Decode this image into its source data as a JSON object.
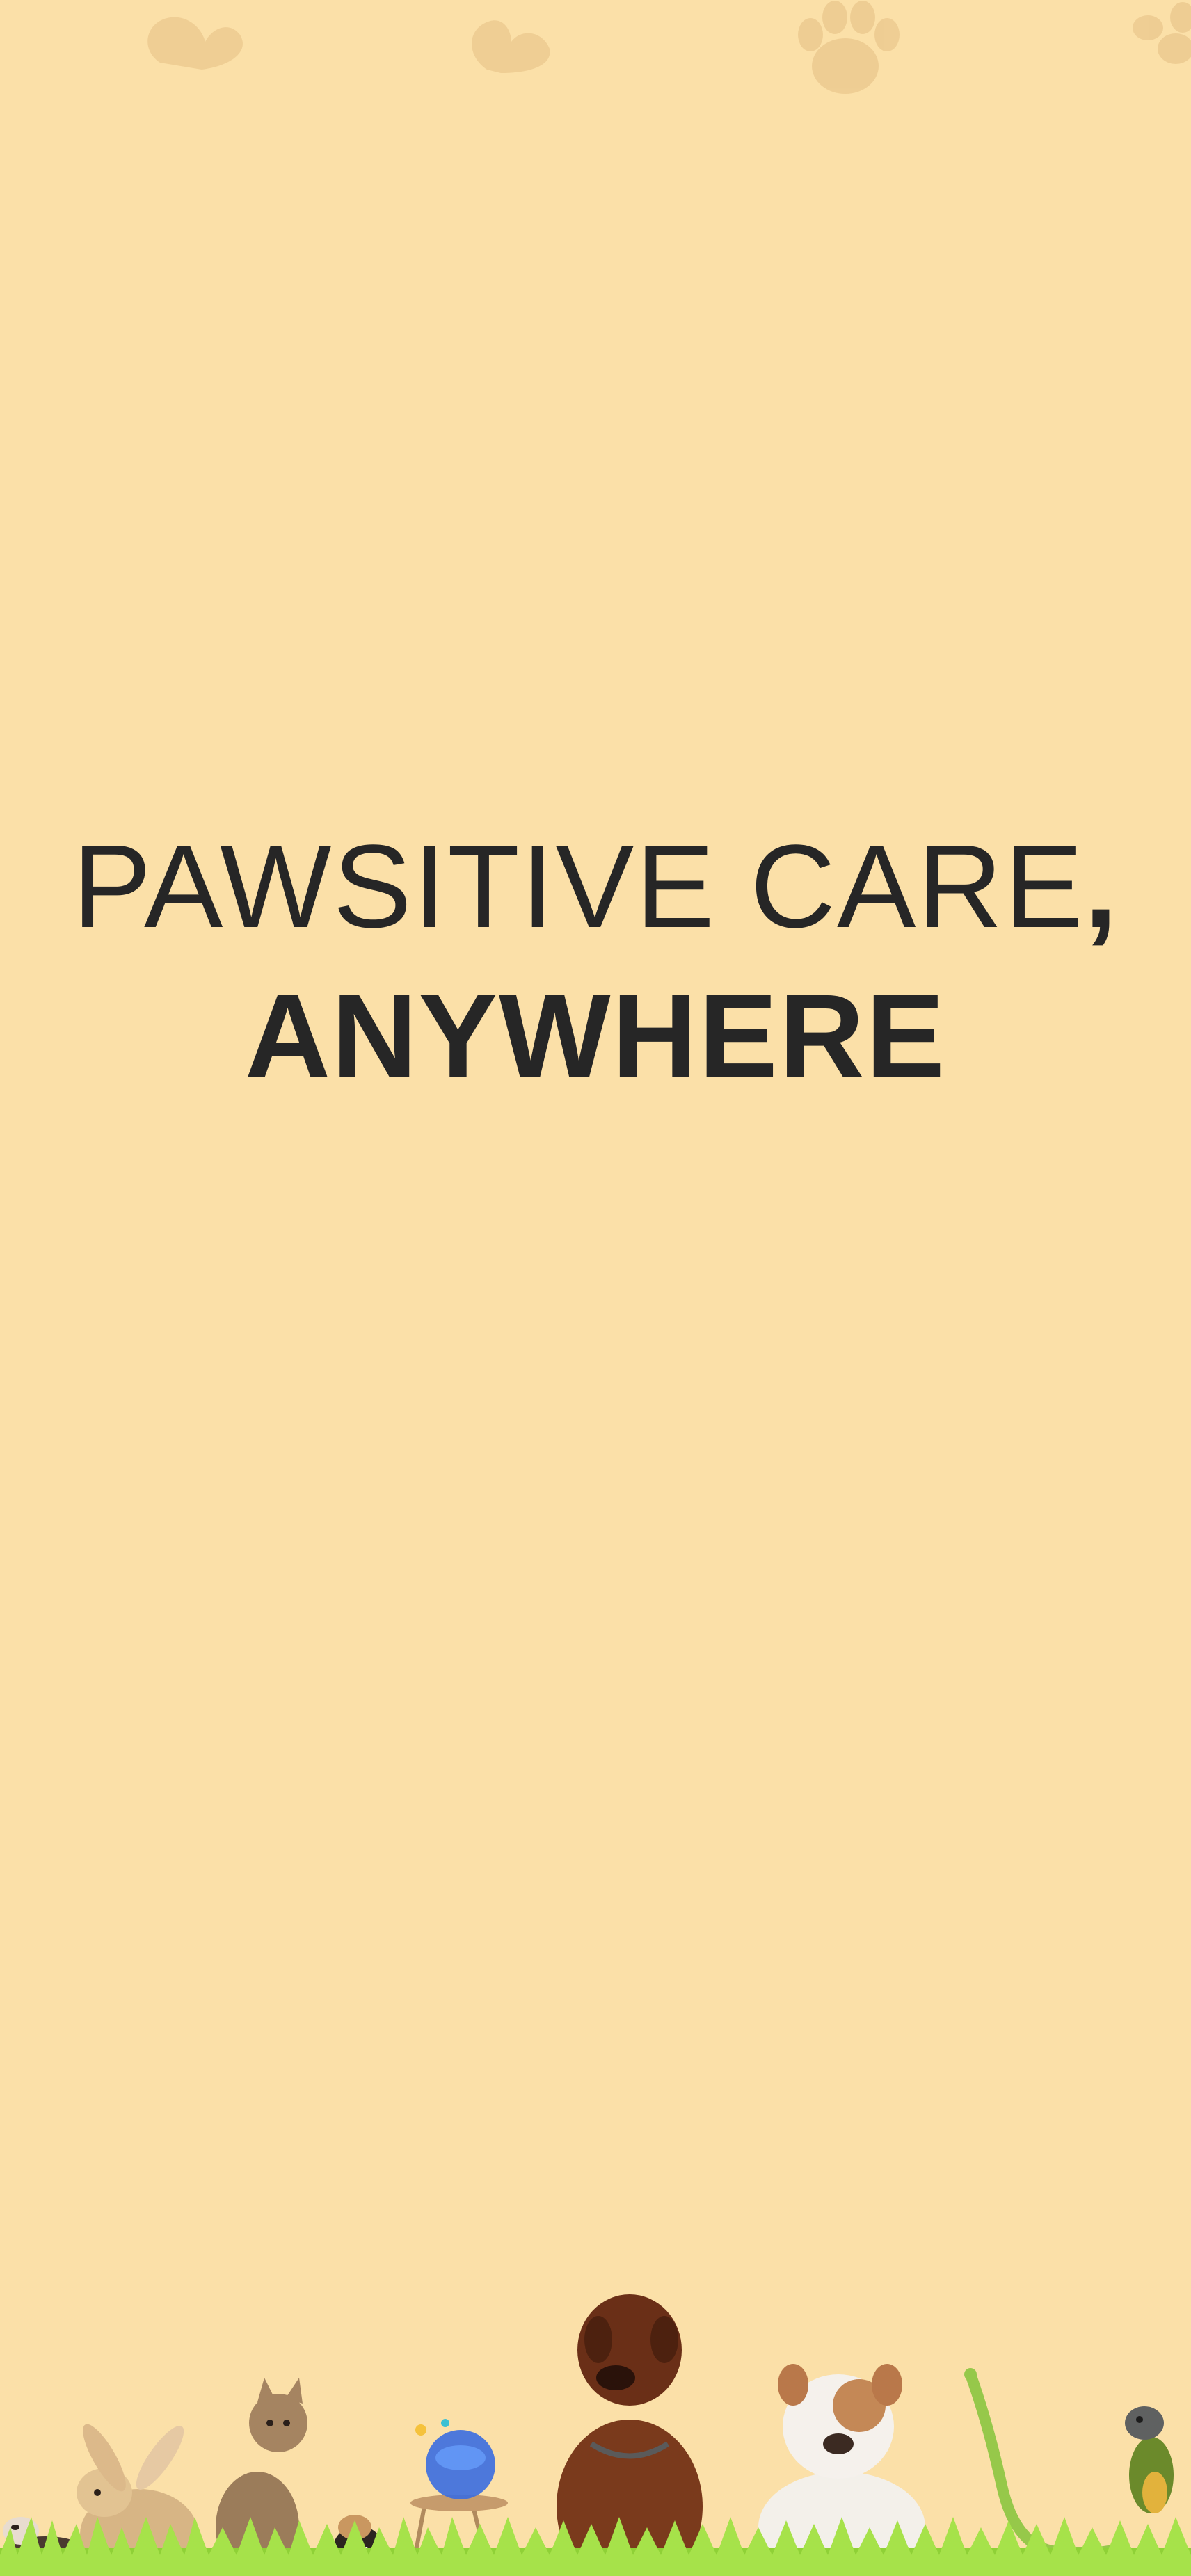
{
  "headline": {
    "line1": "PAWSITIVE CARE",
    "line1_punct": ",",
    "line2": "ANYWHERE"
  },
  "colors": {
    "background": "#fbe0a8",
    "text": "#262626",
    "paw_pattern": "#ecc98f",
    "grass": "#8fd136"
  },
  "scene": {
    "animals": [
      "ferret-image",
      "rabbit-image",
      "cat-image",
      "hamster-image",
      "fishbowl-image",
      "mastiff-dog-image",
      "bulldog-image",
      "snake-image",
      "parrot-image"
    ]
  }
}
